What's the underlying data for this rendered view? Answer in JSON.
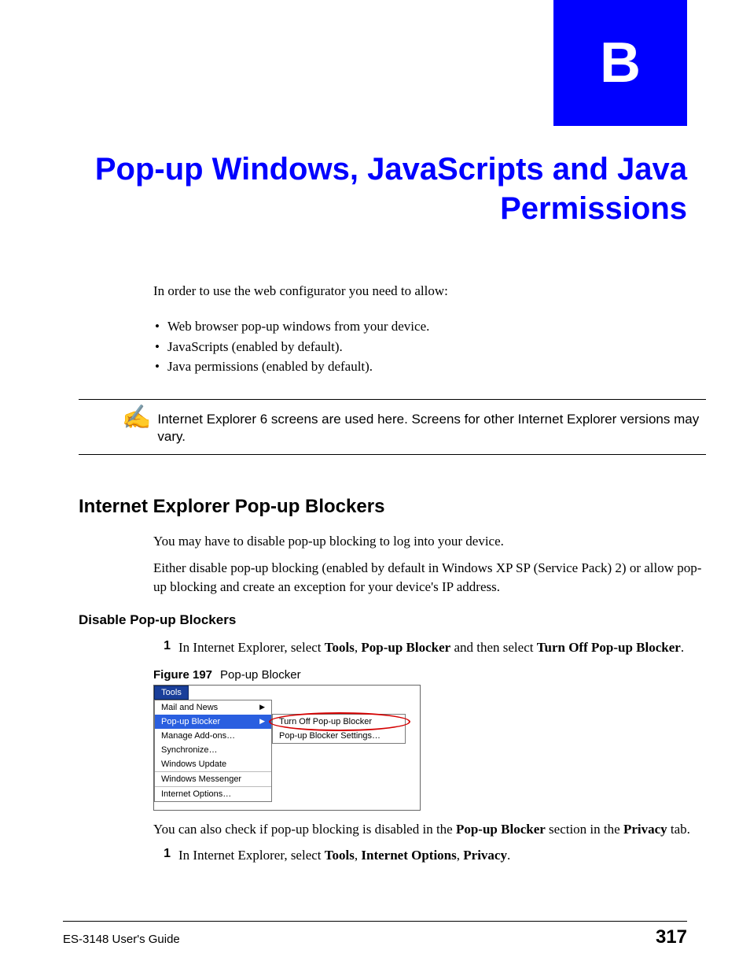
{
  "chapter": {
    "letter": "B",
    "title": "Pop-up Windows, JavaScripts and Java Permissions"
  },
  "intro": "In order to use the web configurator you need to allow:",
  "bullets": [
    "Web browser pop-up windows from your device.",
    "JavaScripts (enabled by default).",
    "Java permissions (enabled by default)."
  ],
  "note": {
    "icon": "✍",
    "text": "Internet Explorer 6 screens are used here. Screens for other Internet Explorer versions may vary."
  },
  "section1": {
    "heading": "Internet Explorer Pop-up Blockers",
    "p1": "You may have to disable pop-up blocking to log into your device.",
    "p2": "Either disable pop-up blocking (enabled by default in Windows XP SP (Service Pack) 2) or allow pop-up blocking and create an exception for your device's IP address."
  },
  "section2": {
    "heading": "Disable Pop-up Blockers",
    "step1_num": "1",
    "step1_pre": "In Internet Explorer, select ",
    "step1_b1": "Tools",
    "step1_sep1": ", ",
    "step1_b2": "Pop-up Blocker",
    "step1_mid": " and then select ",
    "step1_b3": "Turn Off Pop-up Blocker",
    "step1_end": "."
  },
  "figure": {
    "label": "Figure 197",
    "caption": "Pop-up Blocker",
    "tools_tab": "Tools",
    "menu": [
      "Mail and News",
      "Pop-up Blocker",
      "Manage Add-ons…",
      "Synchronize…",
      "Windows Update",
      "Windows Messenger",
      "Internet Options…"
    ],
    "submenu": [
      "Turn Off Pop-up Blocker",
      "Pop-up Blocker Settings…"
    ]
  },
  "after_figure": {
    "p_pre": "You can also check if pop-up blocking is disabled in the ",
    "p_b1": "Pop-up Blocker",
    "p_mid": " section in the ",
    "p_b2": "Privacy",
    "p_end": " tab.",
    "step1_num": "1",
    "step1_pre": "In Internet Explorer, select ",
    "step1_b1": "Tools",
    "step1_sep1": ", ",
    "step1_b2": "Internet Options",
    "step1_sep2": ", ",
    "step1_b3": "Privacy",
    "step1_end": "."
  },
  "footer": {
    "left": "ES-3148 User's Guide",
    "right": "317"
  }
}
